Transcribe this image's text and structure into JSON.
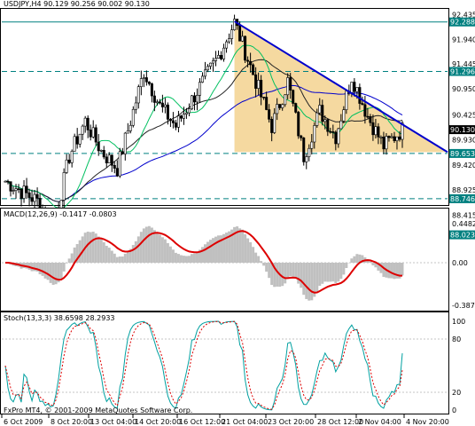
{
  "window": {
    "title": "USDJPY,H4 90.129 90.256 90.002 90.130",
    "watermark": "FxPro MT4, © 2001-2009 MetaQuotes Software Corp."
  },
  "chart_data": [
    {
      "type": "candlestick",
      "panel": "main",
      "symbol": "USDJPY",
      "timeframe": "H4",
      "ohlc": {
        "open": 90.129,
        "high": 90.256,
        "low": 90.002,
        "close": 90.13
      },
      "ylim": [
        88.62,
        92.55
      ],
      "y_ticks": [
        "92.435",
        "91.940",
        "91.445",
        "90.950",
        "90.425",
        "89.930",
        "89.420",
        "88.925",
        "88.415"
      ],
      "price_tags": [
        {
          "value": "92.288",
          "color": "#008080"
        },
        {
          "value": "91.296",
          "color": "#008080"
        },
        {
          "value": "90.130",
          "color": "#000000"
        },
        {
          "value": "89.653",
          "color": "#008080"
        },
        {
          "value": "88.746",
          "color": "#008080"
        },
        {
          "value": "88.023",
          "color": "#008080"
        }
      ],
      "x_ticks": [
        "6 Oct 2009",
        "8 Oct 20:00",
        "13 Oct 04:00",
        "14 Oct 20:00",
        "16 Oct 12:00",
        "21 Oct 04:00",
        "23 Oct 20:00",
        "28 Oct 12:00",
        "2 Nov 04:00",
        "4 Nov 20:00"
      ],
      "colors": {
        "candle": "#000000",
        "ma_long": "#0000cc",
        "ma_mid": "#222222",
        "ma_short": "#00c060",
        "trendline": "#0000cc",
        "triangle": "#f5d9a0",
        "level": "#008080"
      }
    },
    {
      "type": "histogram+line",
      "panel": "macd",
      "title": "MACD(12,26,9) -0.1417 -0.0803",
      "y_ticks": [
        "0.4482",
        "0.00",
        "-0.3878"
      ],
      "colors": {
        "histogram": "#c0c0c0",
        "signal": "#dd0000"
      }
    },
    {
      "type": "line",
      "panel": "stochastic",
      "title": "Stoch(13,3,3) 38.6598 28.2933",
      "y_ticks": [
        "100",
        "80",
        "20",
        "0"
      ],
      "colors": {
        "main": "#00a0a0",
        "signal": "#dd0000"
      }
    }
  ]
}
